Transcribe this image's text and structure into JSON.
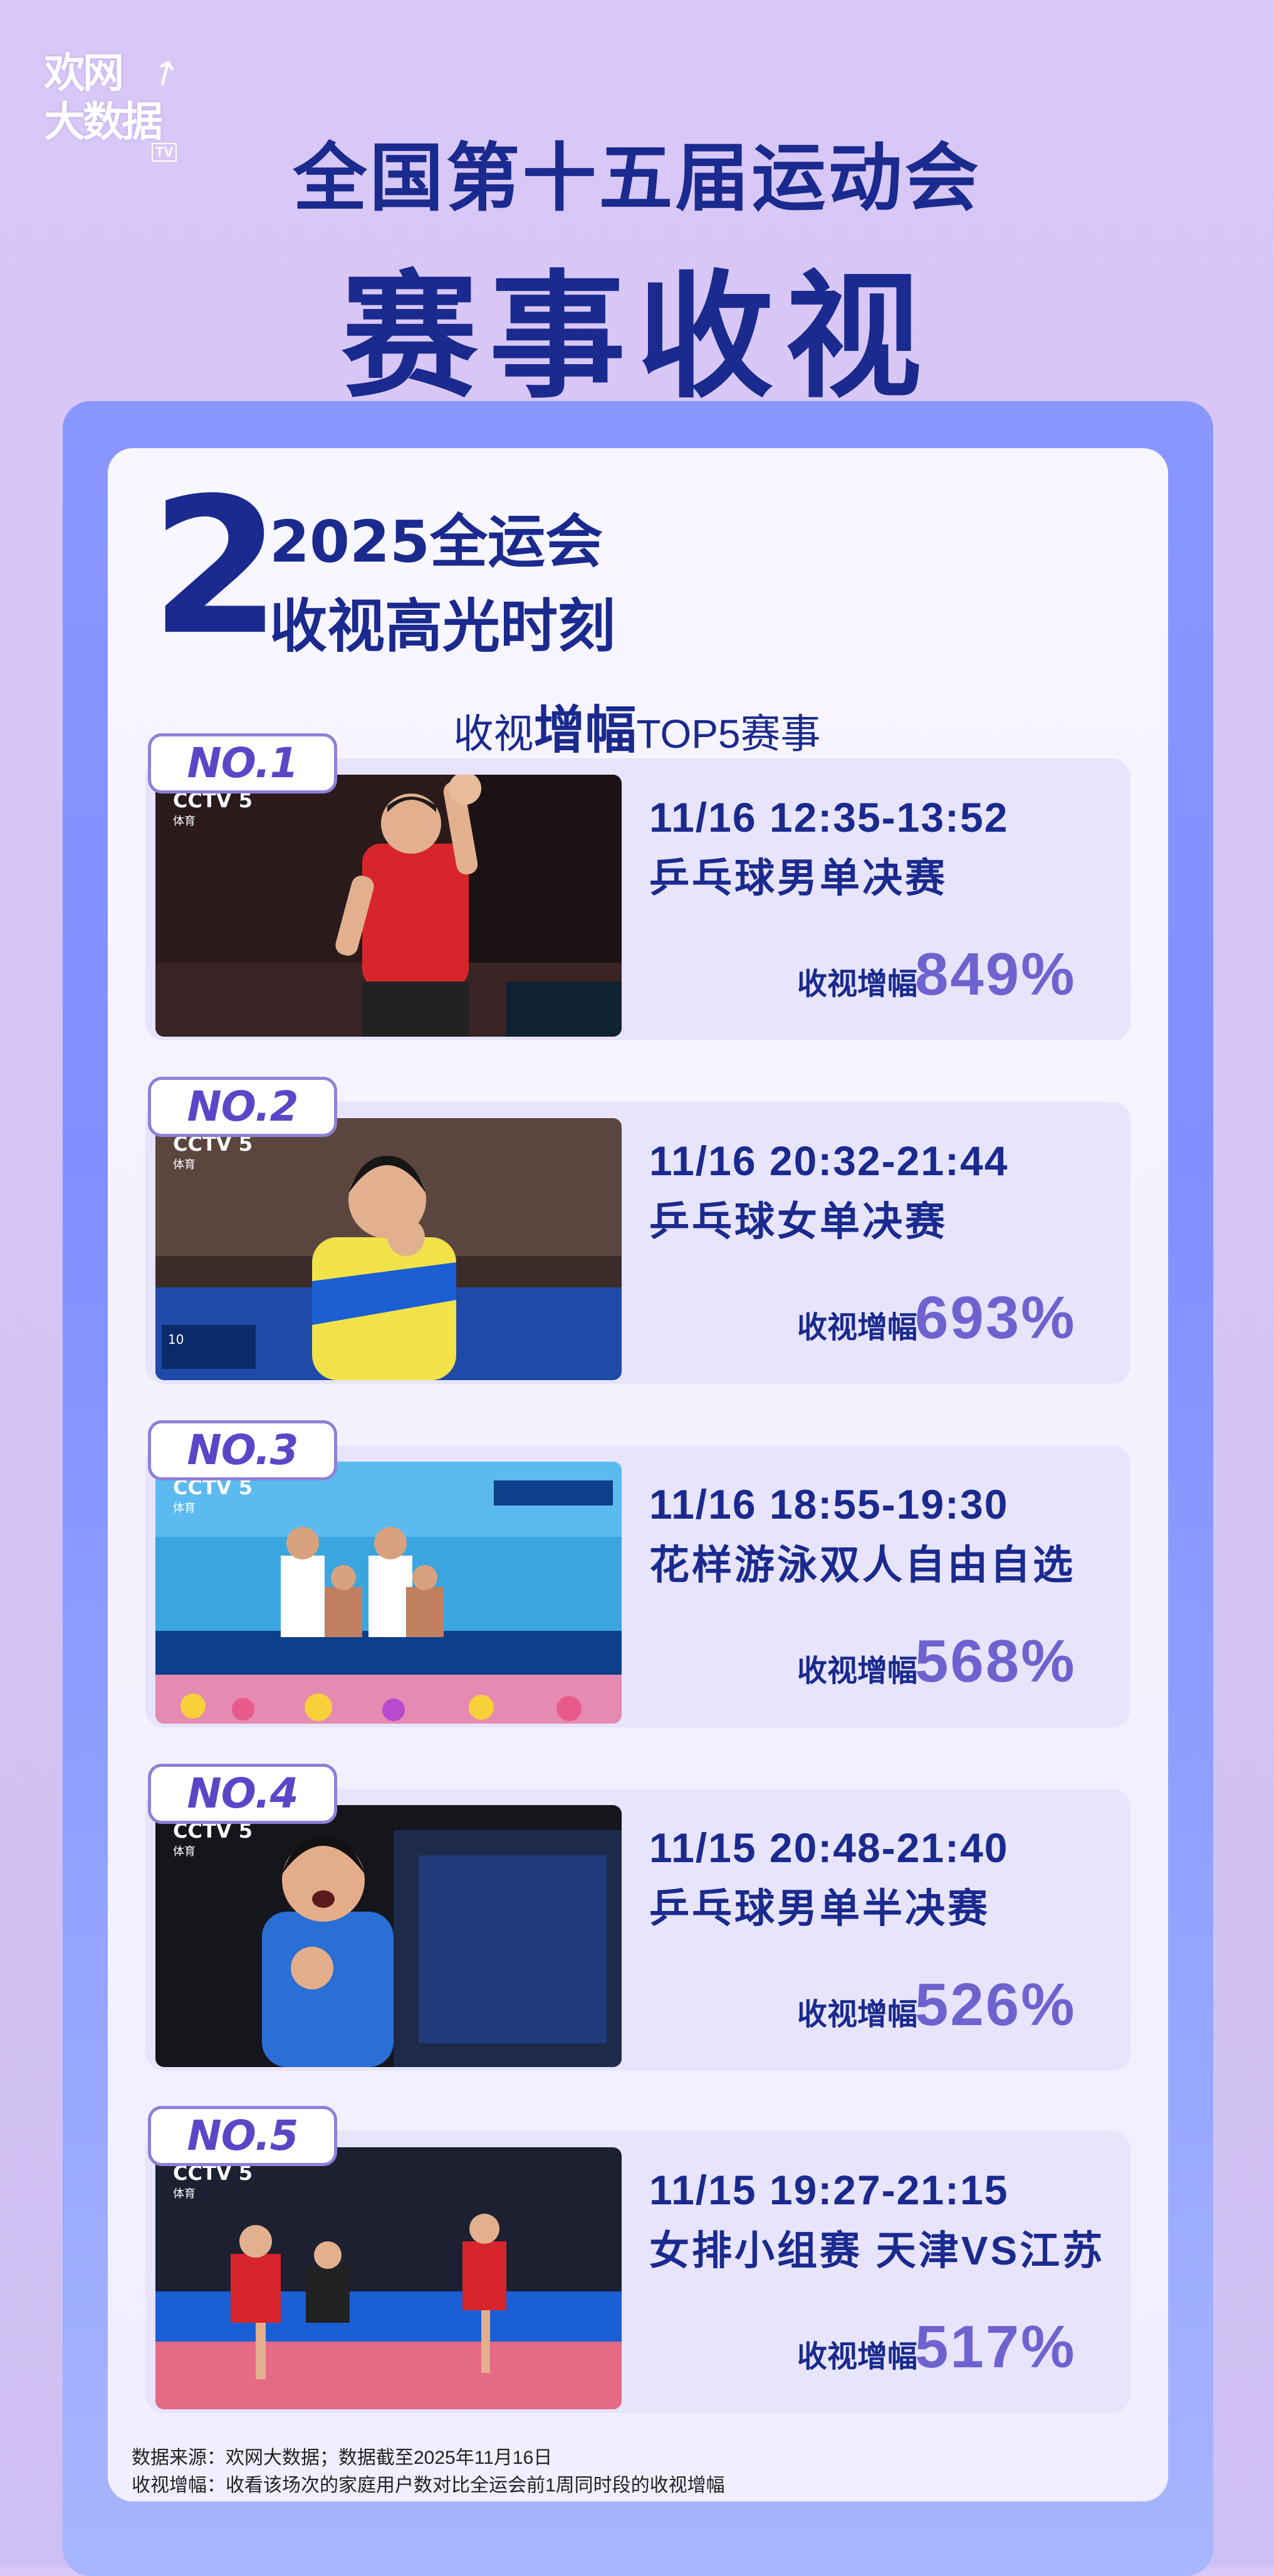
{
  "logo": {
    "line1": "欢网",
    "line2": "大数据",
    "tv": "TV",
    "arrow": "↗"
  },
  "header": {
    "title_line1": "全国第十五届运动会",
    "title_line2": "赛事收视"
  },
  "highlight": {
    "number": "2",
    "line1": "2025全运会",
    "line2": "收视高光时刻",
    "subtitle_pre": "收视",
    "subtitle_em": "增幅",
    "subtitle_post": "TOP5赛事"
  },
  "events": [
    {
      "rank": "NO.1",
      "time": "11/16  12:35-13:52",
      "name": "乒乓球男单决赛",
      "rate_label": "收视增幅",
      "rate": "849%",
      "rate_value": 849,
      "photo_icon": "table-tennis-player-waving"
    },
    {
      "rank": "NO.2",
      "time": "11/16  20:32-21:44",
      "name": "乒乓球女单决赛",
      "rate_label": "收视增幅",
      "rate": "693%",
      "rate_value": 693,
      "photo_icon": "table-tennis-player-celebrating"
    },
    {
      "rank": "NO.3",
      "time": "11/16  18:55-19:30",
      "name": "花样游泳双人自由自选",
      "rate_label": "收视增幅",
      "rate": "568%",
      "rate_value": 568,
      "photo_icon": "synchronized-swimming-podium"
    },
    {
      "rank": "NO.4",
      "time": "11/15  20:48-21:40",
      "name": "乒乓球男单半决赛",
      "rate_label": "收视增幅",
      "rate": "526%",
      "rate_value": 526,
      "photo_icon": "table-tennis-player-shouting"
    },
    {
      "rank": "NO.5",
      "time": "11/15  19:27-21:15",
      "name": "女排小组赛 天津VS江苏",
      "rate_label": "收视增幅",
      "rate": "517%",
      "rate_value": 517,
      "photo_icon": "volleyball-match"
    }
  ],
  "broadcast": {
    "channel": "CCTV 5",
    "sub": "体育"
  },
  "footnote": {
    "line1": "数据来源：欢网大数据；数据截至2025年11月16日",
    "line2": "收视增幅：收看该场次的家庭用户数对比全运会前1周同时段的收视增幅"
  },
  "colors": {
    "navy": "#1a2a8e",
    "accent": "#6f62cf",
    "background": "#d9c8f7",
    "frame": "#8a97ff"
  }
}
